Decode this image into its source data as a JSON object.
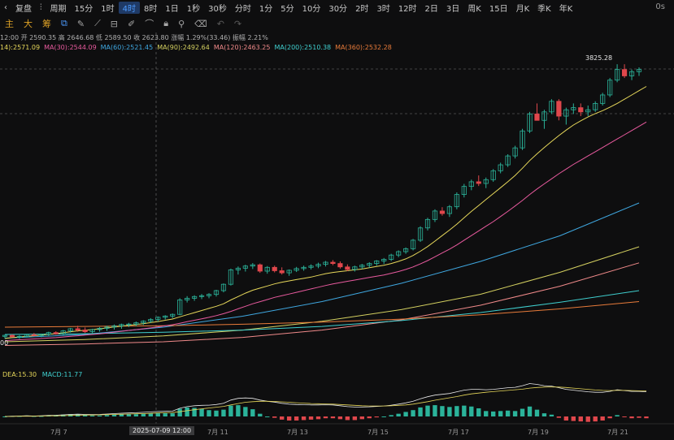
{
  "toolbar": {
    "back_icon": "chevron-left",
    "replay_label": "复盘",
    "chart_type_icon": "candles-icon",
    "period_label": "周期",
    "timeframes": [
      "15分",
      "1时",
      "4时",
      "8时",
      "1日",
      "1秒",
      "30秒",
      "分时",
      "1分",
      "5分",
      "10分",
      "30分",
      "2时",
      "3时",
      "12时",
      "2日",
      "3日",
      "周K",
      "15日",
      "月K",
      "季K",
      "年K"
    ],
    "active_timeframe": "4时",
    "right_label": "0s"
  },
  "indicator_tabs": [
    "主",
    "大",
    "筹"
  ],
  "ohlc_text": "12:00  开 2590.35  高 2646.68  低 2589.50  收 2623.80  涨幅 1.29%(33.46)  振幅 2.21%",
  "ma_values": [
    {
      "label": "14):2571.09",
      "color": "#e6d75a"
    },
    {
      "label": "MA(30):2544.09",
      "color": "#e85a9e"
    },
    {
      "label": "MA(60):2521.45",
      "color": "#3fa7e0"
    },
    {
      "label": "MA(90):2492.64",
      "color": "#d4d060"
    },
    {
      "label": "MA(120):2463.25",
      "color": "#f08a8a"
    },
    {
      "label": "MA(200):2510.38",
      "color": "#3fcfcf"
    },
    {
      "label": "MA(360):2532.28",
      "color": "#e87b3a"
    }
  ],
  "high_marker": "3825.28",
  "left_price_tag": "00",
  "macd": {
    "dea_label": "DEA:15.30",
    "macd_label": "MACD:11.77",
    "dea_color": "#e6d75a",
    "macd_color": "#3fcfcf"
  },
  "x_labels": [
    "7月 7",
    "7月 11",
    "7月 13",
    "7月 15",
    "7月 17",
    "7月 19",
    "7月 21"
  ],
  "crosshair_date": "2025-07-09 12:00",
  "colors": {
    "up": "#2bb39a",
    "down": "#e0474c",
    "bg": "#0e0e0f"
  },
  "chart_data": {
    "type": "candlestick",
    "candles": [
      [
        2540,
        2548,
        2530,
        2545
      ],
      [
        2545,
        2550,
        2535,
        2538
      ],
      [
        2538,
        2546,
        2528,
        2540
      ],
      [
        2540,
        2552,
        2534,
        2548
      ],
      [
        2548,
        2556,
        2540,
        2544
      ],
      [
        2544,
        2552,
        2536,
        2550
      ],
      [
        2550,
        2562,
        2542,
        2558
      ],
      [
        2558,
        2564,
        2548,
        2552
      ],
      [
        2552,
        2570,
        2546,
        2566
      ],
      [
        2566,
        2580,
        2558,
        2576
      ],
      [
        2576,
        2590,
        2562,
        2570
      ],
      [
        2570,
        2582,
        2556,
        2562
      ],
      [
        2562,
        2576,
        2552,
        2572
      ],
      [
        2572,
        2584,
        2562,
        2578
      ],
      [
        2578,
        2590,
        2566,
        2584
      ],
      [
        2584,
        2596,
        2572,
        2590
      ],
      [
        2590,
        2600,
        2576,
        2596
      ],
      [
        2596,
        2604,
        2584,
        2598
      ],
      [
        2598,
        2610,
        2588,
        2604
      ],
      [
        2604,
        2616,
        2594,
        2612
      ],
      [
        2612,
        2626,
        2604,
        2620
      ],
      [
        2620,
        2634,
        2610,
        2630
      ],
      [
        2630,
        2640,
        2620,
        2636
      ],
      [
        2636,
        2648,
        2626,
        2644
      ],
      [
        2644,
        2720,
        2640,
        2712
      ],
      [
        2712,
        2730,
        2700,
        2720
      ],
      [
        2720,
        2734,
        2708,
        2728
      ],
      [
        2728,
        2740,
        2716,
        2732
      ],
      [
        2732,
        2744,
        2720,
        2738
      ],
      [
        2738,
        2760,
        2728,
        2756
      ],
      [
        2756,
        2790,
        2748,
        2786
      ],
      [
        2786,
        2860,
        2780,
        2854
      ],
      [
        2854,
        2870,
        2832,
        2862
      ],
      [
        2862,
        2878,
        2846,
        2872
      ],
      [
        2872,
        2886,
        2858,
        2878
      ],
      [
        2878,
        2884,
        2840,
        2848
      ],
      [
        2848,
        2872,
        2836,
        2866
      ],
      [
        2866,
        2874,
        2842,
        2850
      ],
      [
        2850,
        2866,
        2832,
        2840
      ],
      [
        2840,
        2856,
        2826,
        2852
      ],
      [
        2852,
        2868,
        2844,
        2860
      ],
      [
        2860,
        2874,
        2850,
        2866
      ],
      [
        2866,
        2880,
        2856,
        2872
      ],
      [
        2872,
        2888,
        2862,
        2880
      ],
      [
        2880,
        2896,
        2870,
        2890
      ],
      [
        2890,
        2900,
        2876,
        2884
      ],
      [
        2884,
        2894,
        2860,
        2868
      ],
      [
        2868,
        2880,
        2848,
        2856
      ],
      [
        2856,
        2874,
        2846,
        2868
      ],
      [
        2868,
        2882,
        2858,
        2876
      ],
      [
        2876,
        2890,
        2864,
        2884
      ],
      [
        2884,
        2900,
        2874,
        2896
      ],
      [
        2896,
        2910,
        2882,
        2904
      ],
      [
        2904,
        2930,
        2896,
        2924
      ],
      [
        2924,
        2946,
        2914,
        2940
      ],
      [
        2940,
        2960,
        2930,
        2954
      ],
      [
        2954,
        3000,
        2946,
        2994
      ],
      [
        2994,
        3060,
        2986,
        3052
      ],
      [
        3052,
        3100,
        3040,
        3092
      ],
      [
        3092,
        3140,
        3080,
        3132
      ],
      [
        3132,
        3150,
        3110,
        3120
      ],
      [
        3120,
        3160,
        3104,
        3152
      ],
      [
        3152,
        3220,
        3140,
        3210
      ],
      [
        3210,
        3260,
        3196,
        3248
      ],
      [
        3248,
        3280,
        3230,
        3270
      ],
      [
        3270,
        3300,
        3250,
        3262
      ],
      [
        3262,
        3290,
        3240,
        3280
      ],
      [
        3280,
        3330,
        3270,
        3322
      ],
      [
        3322,
        3360,
        3310,
        3350
      ],
      [
        3350,
        3400,
        3340,
        3392
      ],
      [
        3392,
        3440,
        3380,
        3430
      ],
      [
        3430,
        3520,
        3420,
        3510
      ],
      [
        3510,
        3600,
        3500,
        3590
      ],
      [
        3590,
        3640,
        3570,
        3560
      ],
      [
        3560,
        3610,
        3520,
        3600
      ],
      [
        3600,
        3660,
        3590,
        3650
      ],
      [
        3650,
        3660,
        3560,
        3580
      ],
      [
        3580,
        3620,
        3540,
        3610
      ],
      [
        3610,
        3640,
        3590,
        3620
      ],
      [
        3620,
        3640,
        3580,
        3600
      ],
      [
        3600,
        3630,
        3580,
        3610
      ],
      [
        3610,
        3650,
        3600,
        3640
      ],
      [
        3640,
        3690,
        3630,
        3680
      ],
      [
        3680,
        3760,
        3670,
        3750
      ],
      [
        3750,
        3825,
        3740,
        3800
      ],
      [
        3800,
        3825,
        3760,
        3770
      ],
      [
        3770,
        3800,
        3750,
        3790
      ],
      [
        3790,
        3810,
        3770,
        3800
      ]
    ],
    "ma": [
      {
        "name": "MA(14)",
        "color": "#e6d75a",
        "values": [
          2530,
          2534,
          2537,
          2540,
          2543,
          2546,
          2550,
          2553,
          2557,
          2562,
          2566,
          2569,
          2572,
          2576,
          2580,
          2584,
          2588,
          2592,
          2596,
          2600,
          2605,
          2610,
          2616,
          2622,
          2632,
          2642,
          2652,
          2662,
          2672,
          2682,
          2694,
          2712,
          2728,
          2744,
          2758,
          2768,
          2778,
          2788,
          2796,
          2802,
          2808,
          2814,
          2820,
          2828,
          2836,
          2842,
          2846,
          2850,
          2854,
          2858,
          2864,
          2870,
          2876,
          2884,
          2894,
          2906,
          2922,
          2942,
          2964,
          2990,
          3016,
          3042,
          3070,
          3100,
          3130,
          3158,
          3186,
          3214,
          3242,
          3270,
          3300,
          3334,
          3370,
          3402,
          3432,
          3460,
          3488,
          3514,
          3538,
          3558,
          3576,
          3592,
          3606,
          3622,
          3640,
          3660,
          3680,
          3700,
          3720
        ]
      },
      {
        "name": "MA(30)",
        "color": "#e85a9e",
        "values": [
          2520,
          2522,
          2524,
          2526,
          2528,
          2530,
          2532,
          2534,
          2537,
          2540,
          2543,
          2546,
          2549,
          2552,
          2556,
          2560,
          2564,
          2568,
          2572,
          2576,
          2580,
          2585,
          2590,
          2595,
          2602,
          2609,
          2616,
          2623,
          2630,
          2638,
          2647,
          2658,
          2670,
          2682,
          2694,
          2704,
          2714,
          2724,
          2732,
          2740,
          2748,
          2756,
          2764,
          2772,
          2780,
          2788,
          2794,
          2800,
          2806,
          2812,
          2818,
          2824,
          2830,
          2838,
          2846,
          2856,
          2868,
          2882,
          2898,
          2916,
          2934,
          2952,
          2972,
          2994,
          3016,
          3038,
          3060,
          3082,
          3106,
          3130,
          3156,
          3182,
          3210,
          3236,
          3260,
          3284,
          3308,
          3330,
          3352,
          3372,
          3392,
          3412,
          3432,
          3452,
          3472,
          3492,
          3512,
          3532,
          3552
        ]
      }
    ],
    "macd": {
      "dif": [
        0,
        1,
        2,
        3,
        2,
        3,
        5,
        6,
        8,
        10,
        11,
        10,
        9,
        10,
        12,
        14,
        16,
        17,
        18,
        20,
        22,
        24,
        25,
        26,
        40,
        48,
        52,
        54,
        55,
        58,
        64,
        80,
        88,
        90,
        88,
        80,
        74,
        70,
        64,
        60,
        58,
        57,
        56,
        56,
        57,
        56,
        52,
        48,
        46,
        46,
        47,
        49,
        51,
        55,
        60,
        66,
        74,
        86,
        96,
        104,
        108,
        112,
        120,
        128,
        132,
        132,
        130,
        132,
        136,
        140,
        142,
        150,
        160,
        156,
        150,
        148,
        140,
        132,
        128,
        124,
        120,
        118,
        118,
        122,
        130,
        126,
        122,
        122,
        120
      ],
      "dea": [
        0,
        0,
        1,
        1,
        1,
        2,
        3,
        3,
        4,
        5,
        6,
        7,
        7,
        8,
        9,
        10,
        11,
        12,
        13,
        14,
        15,
        17,
        18,
        19,
        23,
        28,
        33,
        37,
        41,
        45,
        49,
        56,
        63,
        69,
        72,
        74,
        74,
        73,
        71,
        69,
        67,
        65,
        63,
        62,
        61,
        60,
        58,
        56,
        54,
        52,
        51,
        51,
        51,
        52,
        54,
        56,
        60,
        66,
        72,
        79,
        85,
        91,
        97,
        104,
        110,
        114,
        118,
        121,
        124,
        127,
        130,
        133,
        138,
        141,
        143,
        144,
        143,
        141,
        138,
        135,
        132,
        129,
        127,
        126,
        127,
        127,
        126,
        125,
        124
      ]
    }
  }
}
